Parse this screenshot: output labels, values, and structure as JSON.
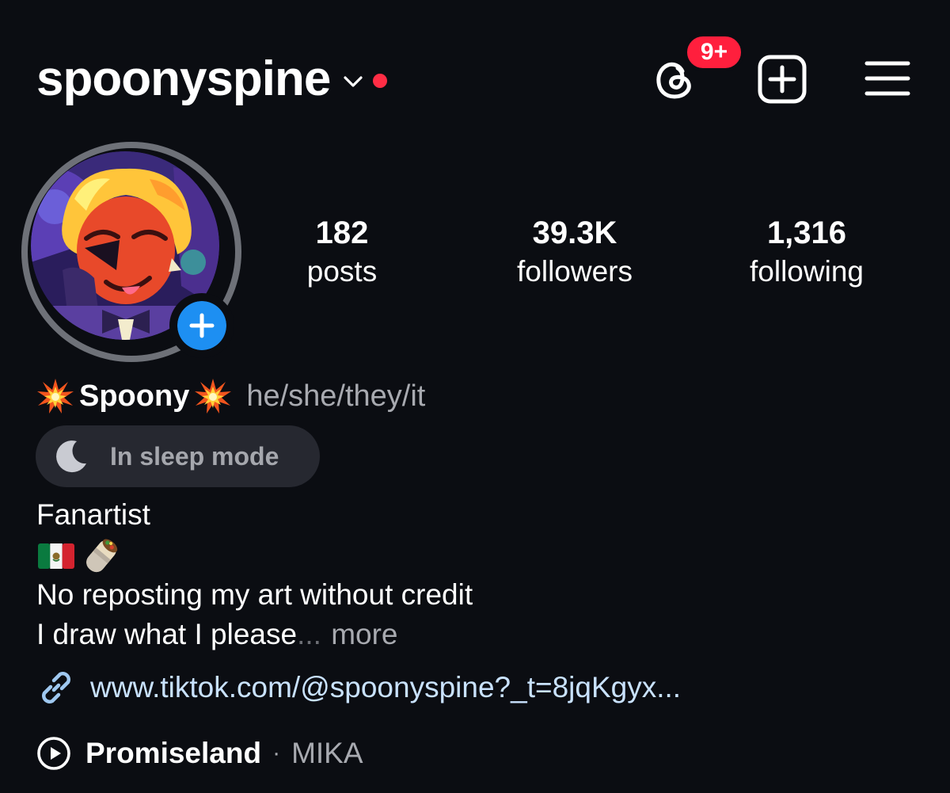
{
  "header": {
    "username": "spoonyspine",
    "threads_badge": "9+"
  },
  "stats": {
    "posts": {
      "value": "182",
      "label": "posts"
    },
    "followers": {
      "value": "39.3K",
      "label": "followers"
    },
    "following": {
      "value": "1,316",
      "label": "following"
    }
  },
  "profile": {
    "display_name": "Spoony",
    "pronouns": "he/she/they/it",
    "status_note": "In sleep mode"
  },
  "bio": {
    "line1": "Fanartist",
    "line3": "No reposting my art without credit",
    "line4": "I draw what I please",
    "ellipsis": "...",
    "more": "more"
  },
  "link": {
    "url": "www.tiktok.com/@spoonyspine?_t=8jqKgyx..."
  },
  "music": {
    "title": "Promiseland",
    "separator": "·",
    "artist": "MIKA"
  },
  "icons": {
    "threads": "threads-icon",
    "create": "plus-square-icon",
    "menu": "hamburger-menu-icon",
    "avatar_add": "plus-icon",
    "name_decoration": "collision-emoji-icon",
    "sleep": "moon-icon",
    "flag": "mexico-flag-emoji-icon",
    "burrito": "burrito-emoji-icon",
    "link": "link-icon",
    "play": "play-icon"
  },
  "colors": {
    "background": "#0b0d12",
    "badge": "#ff1f3d",
    "accent_blue": "#1d8ff2",
    "link": "#c9e2ff",
    "muted_text": "#a8aab0"
  }
}
